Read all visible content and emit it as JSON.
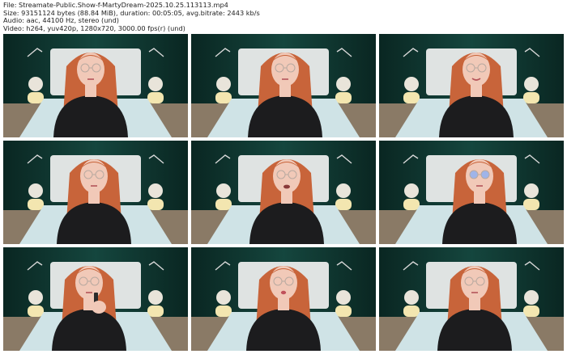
{
  "header": {
    "file_line": "File: Streamate-Public.Show-f-MartyDream-2025.10.25.113113.mp4",
    "size_line": "Size: 93151124 bytes (88.84 MiB), duration: 00:05:05, avg.bitrate: 2443 kb/s",
    "audio_line": "Audio: aac, 44100 Hz, stereo (und)",
    "video_line": "Video: h264, yuv420p, 1280x720, 3000.00 fps(r) (und)"
  },
  "colors": {
    "wall": "#0f3b34",
    "bed": "#cfe3e6",
    "headboard": "#dfe3e2",
    "hair": "#c8643a",
    "skin": "#f1c9b8",
    "top": "#1c1c1e",
    "lamp": "#f3e6b0"
  },
  "thumbnails": [
    {
      "glasses": "clear",
      "mouth": "closed",
      "hand": false
    },
    {
      "glasses": "clear",
      "mouth": "closed",
      "hand": false
    },
    {
      "glasses": "clear",
      "mouth": "smile",
      "hand": false
    },
    {
      "glasses": "clear",
      "mouth": "closed",
      "hand": false
    },
    {
      "glasses": "clear",
      "mouth": "open",
      "hand": false
    },
    {
      "glasses": "blue",
      "mouth": "closed",
      "hand": false
    },
    {
      "glasses": "clear",
      "mouth": "closed",
      "hand": true
    },
    {
      "glasses": "clear",
      "mouth": "pout",
      "hand": false
    },
    {
      "glasses": "clear",
      "mouth": "closed",
      "hand": false
    }
  ]
}
